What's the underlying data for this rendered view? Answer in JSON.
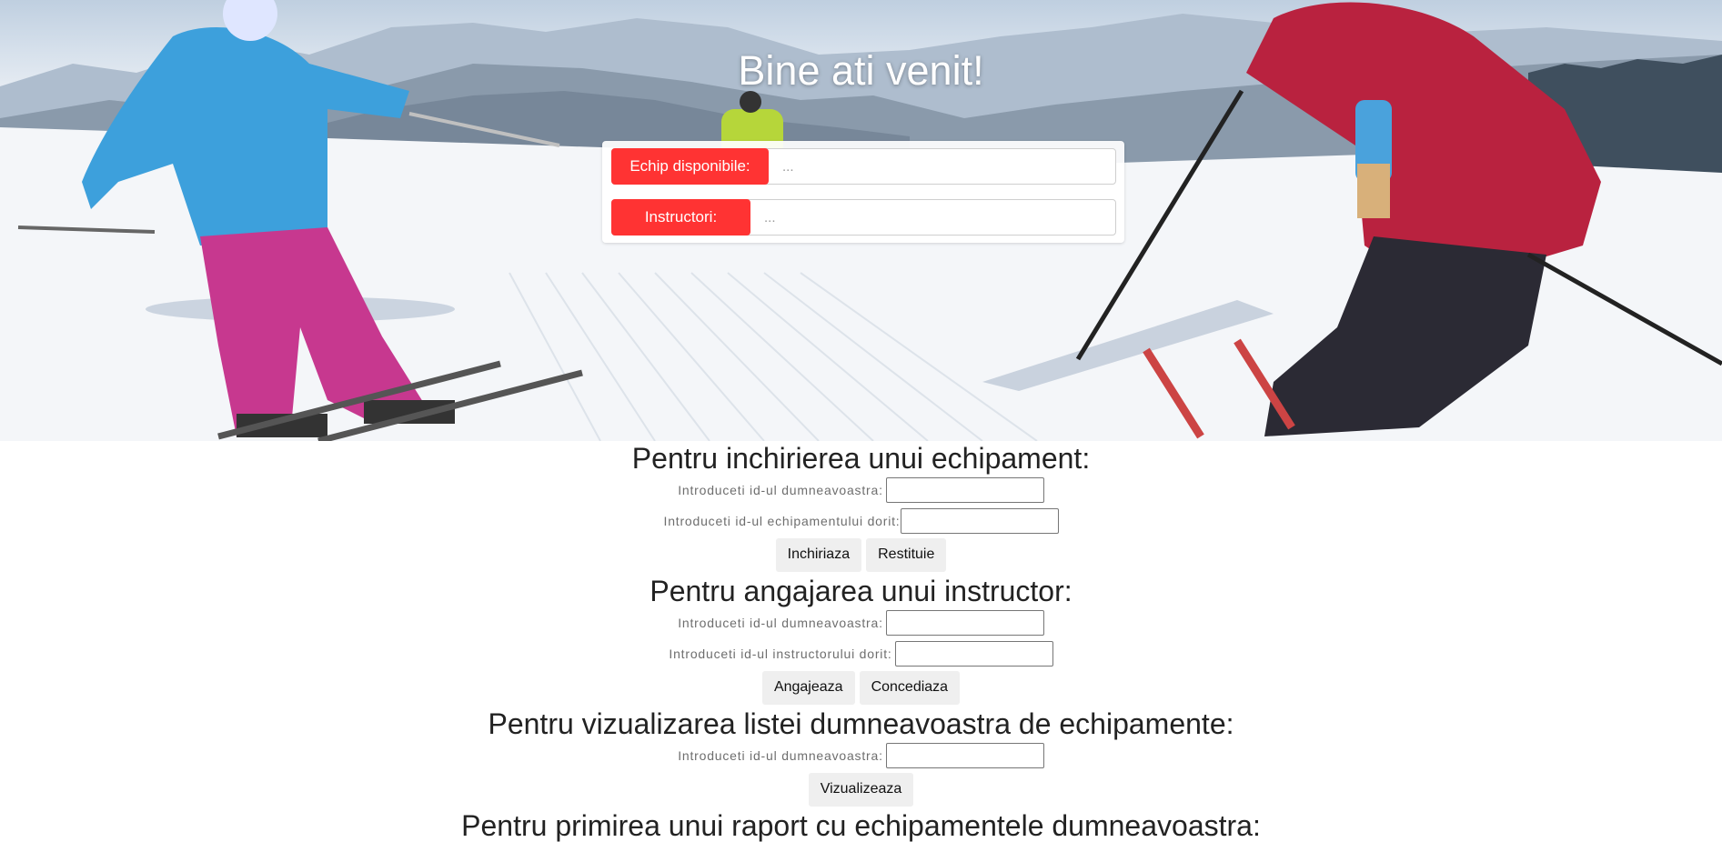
{
  "hero": {
    "title": "Bine ati venit!",
    "equipment": {
      "label": "Echip disponibile:",
      "value": "..."
    },
    "instructors": {
      "label": "Instructori:",
      "value": "..."
    }
  },
  "rent_section": {
    "title": "Pentru inchirierea unui echipament:",
    "user_id_label": "Introduceti id-ul dumneavoastra:",
    "user_id_value": "",
    "equipment_id_label": "Introduceti id-ul echipamentului dorit:",
    "equipment_id_value": "",
    "rent_button": "Inchiriaza",
    "return_button": "Restituie"
  },
  "hire_section": {
    "title": "Pentru angajarea unui instructor:",
    "user_id_label": "Introduceti id-ul dumneavoastra:",
    "user_id_value": "",
    "instructor_id_label": "Introduceti id-ul instructorului dorit:",
    "instructor_id_value": "",
    "hire_button": "Angajeaza",
    "fire_button": "Concediaza"
  },
  "view_section": {
    "title": "Pentru vizualizarea listei dumneavoastra de echipamente:",
    "user_id_label": "Introduceti id-ul dumneavoastra:",
    "user_id_value": "",
    "view_button": "Vizualizeaza"
  },
  "report_section": {
    "title": "Pentru primirea unui raport cu echipamentele dumneavoastra:"
  },
  "colors": {
    "accent_red": "#ff3333",
    "button_bg": "#efefef"
  }
}
